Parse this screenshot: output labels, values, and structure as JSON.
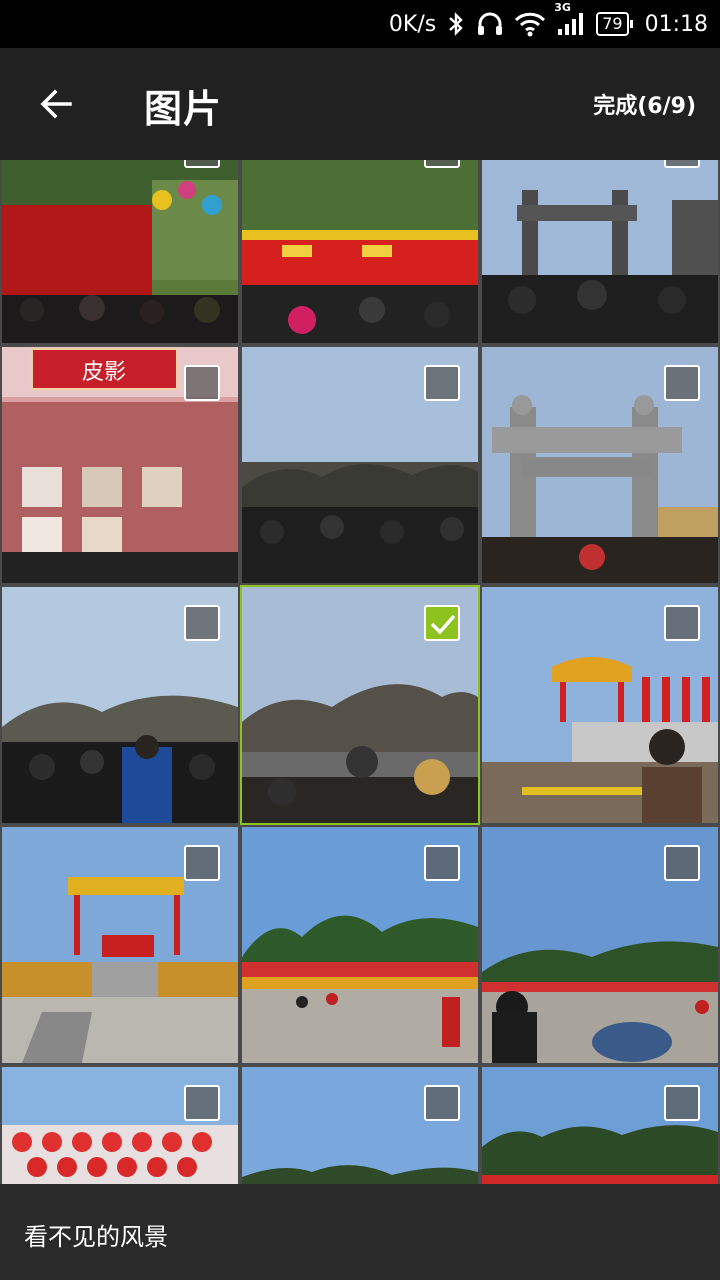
{
  "status_bar": {
    "net_speed": "0K/s",
    "network": "3G",
    "battery": "79",
    "time": "01:18"
  },
  "header": {
    "title": "图片",
    "done_label": "完成(6/9)"
  },
  "photo_grid": {
    "signs": {
      "piying": "皮影"
    },
    "selected_index": 7
  },
  "footer": {
    "album_name": "看不见的风景"
  },
  "colors": {
    "accent_check": "#8dc21f",
    "app_bar": "#212121",
    "bottom_bar": "#2a2a2a"
  }
}
